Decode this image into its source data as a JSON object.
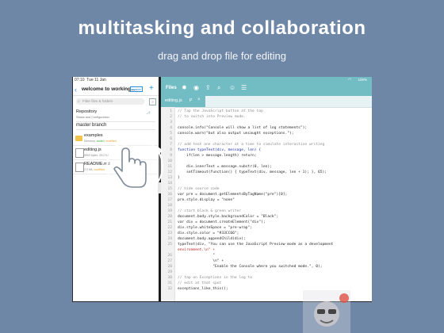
{
  "promo": {
    "headline": "multitasking and collaboration",
    "subhead": "drag and drop file for editing"
  },
  "left_pane": {
    "status_time": "07:10",
    "status_date": "Tue 11 Jan",
    "back_icon": "chevron-left-icon",
    "title": "welcome to working...",
    "badge": "master",
    "add_icon": "plus-icon",
    "search_placeholder": "Filter files & folders",
    "repo": {
      "title": "Repository",
      "subtitle": "Status and Configuration"
    },
    "branch": "master branch",
    "files": [
      {
        "name": "examples",
        "meta_a": "Directory,",
        "meta_b": "added,",
        "meta_c": "modified",
        "type": "folder"
      },
      {
        "name": "editing.js",
        "meta_a": "5593 bytes, 2017/1/1",
        "meta_b": "",
        "meta_c": "",
        "type": "file"
      },
      {
        "name": "README.md",
        "meta_a": "2.0 KB,",
        "meta_b": "",
        "meta_c": "modified",
        "type": "file"
      }
    ]
  },
  "right_pane": {
    "status": "100%",
    "files_label": "Files",
    "toolbar_icons": [
      "gear-icon",
      "eye-icon",
      "share-icon",
      "search-icon",
      "smiley-icon",
      "menu-icon"
    ],
    "tab": {
      "name": "editing.js",
      "pin": "P",
      "close": "×"
    },
    "accent": "#72bcc4"
  },
  "code_lines": [
    {
      "n": "1",
      "text": "// Tap the JavaScript button at the top",
      "kind": "comment"
    },
    {
      "n": "2",
      "text": "// to switch into Preview mode.",
      "kind": "comment"
    },
    {
      "n": "3",
      "text": "",
      "kind": "plain"
    },
    {
      "n": "4",
      "text": "console.info(\"Console will show a list of log statements\");",
      "kind": "plain"
    },
    {
      "n": "5",
      "text": "console.warn(\"but also output uncaught exceptions.\");",
      "kind": "plain"
    },
    {
      "n": "6",
      "text": "",
      "kind": "plain"
    },
    {
      "n": "7",
      "text": "// add text one character at a time to simulate interactive writing",
      "kind": "comment"
    },
    {
      "n": "8",
      "text": "function typeText(div, message, len) {",
      "kind": "kw"
    },
    {
      "n": "9",
      "text": "    if(len > message.length) return;",
      "kind": "plain"
    },
    {
      "n": "10",
      "text": "",
      "kind": "plain"
    },
    {
      "n": "11",
      "text": "    div.innerText = message.substr(0, len);",
      "kind": "plain"
    },
    {
      "n": "12",
      "text": "    setTimeout(function() { typeText(div, message, len + 1); }, 65);",
      "kind": "plain"
    },
    {
      "n": "13",
      "text": "}",
      "kind": "plain"
    },
    {
      "n": "14",
      "text": "",
      "kind": "plain"
    },
    {
      "n": "15",
      "text": "// hide source code",
      "kind": "comment"
    },
    {
      "n": "16",
      "text": "var pre = document.getElementsByTagName(\"pre\")[0];",
      "kind": "plain"
    },
    {
      "n": "17",
      "text": "pre.style.display = \"none\"",
      "kind": "plain"
    },
    {
      "n": "18",
      "text": "",
      "kind": "plain"
    },
    {
      "n": "19",
      "text": "// start black & green writer",
      "kind": "comment"
    },
    {
      "n": "20",
      "text": "document.body.style.backgroundColor = \"Black\";",
      "kind": "plain"
    },
    {
      "n": "21",
      "text": "var div = document.createElement(\"div\");",
      "kind": "plain"
    },
    {
      "n": "22",
      "text": "div.style.whiteSpace = \"pre-wrap\";",
      "kind": "plain"
    },
    {
      "n": "23",
      "text": "div.style.color = \"#33CC66\";",
      "kind": "plain"
    },
    {
      "n": "24",
      "text": "document.body.appendChild(div);",
      "kind": "plain"
    },
    {
      "n": "25",
      "text": "typeText(div, \"You can use the JavaScript Preview mode as a development",
      "kind": "plain"
    },
    {
      "n": "",
      "text": "environment.\\n\" +",
      "kind": "str"
    },
    {
      "n": "26",
      "text": "                \"",
      "kind": "plain"
    },
    {
      "n": "27",
      "text": "                \\n\" +",
      "kind": "plain"
    },
    {
      "n": "28",
      "text": "                \"Enable the Console where you switched mode.\", 0);",
      "kind": "plain"
    },
    {
      "n": "29",
      "text": "",
      "kind": "plain"
    },
    {
      "n": "30",
      "text": "// tap on Exceptions in the log to",
      "kind": "comment"
    },
    {
      "n": "31",
      "text": "// edit at that spot",
      "kind": "comment"
    },
    {
      "n": "32",
      "text": "exceptions_like_this();",
      "kind": "plain"
    }
  ]
}
